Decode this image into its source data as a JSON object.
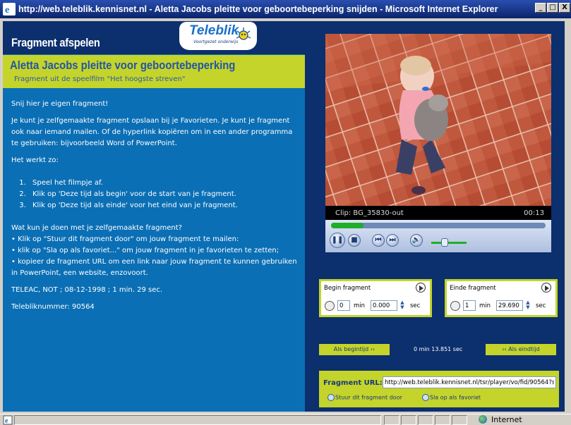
{
  "window": {
    "title": "http://web.teleblik.kennisnet.nl - Aletta Jacobs pleitte voor geboortebeperking snijden - Microsoft Internet Explorer",
    "controls": {
      "minimize": "_",
      "maximize": "□",
      "close": "X"
    }
  },
  "header": {
    "title": "Fragment afspelen",
    "logo_text": "Teleblik",
    "logo_tagline": "Voortgezet onderwijs"
  },
  "fragment_info": {
    "title": "Aletta Jacobs pleitte voor geboortebeperking",
    "subtitle": "Fragment uit de speelfilm \"Het hoogste streven\""
  },
  "body": {
    "intro": "Snij hier je eigen fragment!",
    "description": "Je kunt je zelfgemaakte fragment opslaan bij je Favorieten. Je kunt je fragment ook naar iemand mailen. Of de hyperlink kopiëren om in een ander programma te gebruiken: bijvoorbeeld Word of PowerPoint.",
    "how_title": "Het werkt zo:",
    "steps": [
      "Speel het filmpje af.",
      "Klik op 'Deze tijd als begin' voor de start van je fragment.",
      "Klik op 'Deze tijd als einde' voor het eind van je fragment."
    ],
    "what_title": "Wat kun je doen met je zelfgemaakte fragment?",
    "bullets": [
      "• Klik op \"Stuur dit fragment door\" om jouw fragment te mailen:",
      "• klik op \"Sla op als favoriet...\" om jouw fragment in je favorieten te zetten;",
      "• kopieer de fragment URL om een link naar jouw fragment te kunnen gebruiken in PowerPoint, een website, enzovoort."
    ],
    "meta": "TELEAC, NOT ; 08-12-1998 ; 1 min. 29 sec.",
    "number": "Telebliknummer: 90564"
  },
  "player": {
    "clip_label": "Clip: BG_35830-out",
    "time": "00:13",
    "progress": 0.15
  },
  "begin_fragment": {
    "label": "Begin fragment",
    "min_value": "0",
    "min_label": "min",
    "sec_value": "0.000",
    "sec_label": "sec"
  },
  "end_fragment": {
    "label": "Einde fragment",
    "min_value": "1",
    "min_label": "min",
    "sec_value": "29.690",
    "sec_label": "sec"
  },
  "timing": {
    "as_begin": "Als begintijd ››",
    "current": "0 min 13.851 sec",
    "as_end": "‹‹ Als eindtijd"
  },
  "url_section": {
    "label": "Fragment URL:",
    "value": "http://web.teleblik.kennisnet.nl/tsr/player/vo/fid/90564?s",
    "send_link": "Stuur dit fragment door",
    "favorite_link": "Sla op als favoriet"
  },
  "statusbar": {
    "zone": "Internet"
  },
  "colors": {
    "left_bg": "#0b6fb5",
    "dark_bg": "#0c2f6d",
    "accent_green": "#c4d42a",
    "title_blue": "#2455a6"
  }
}
